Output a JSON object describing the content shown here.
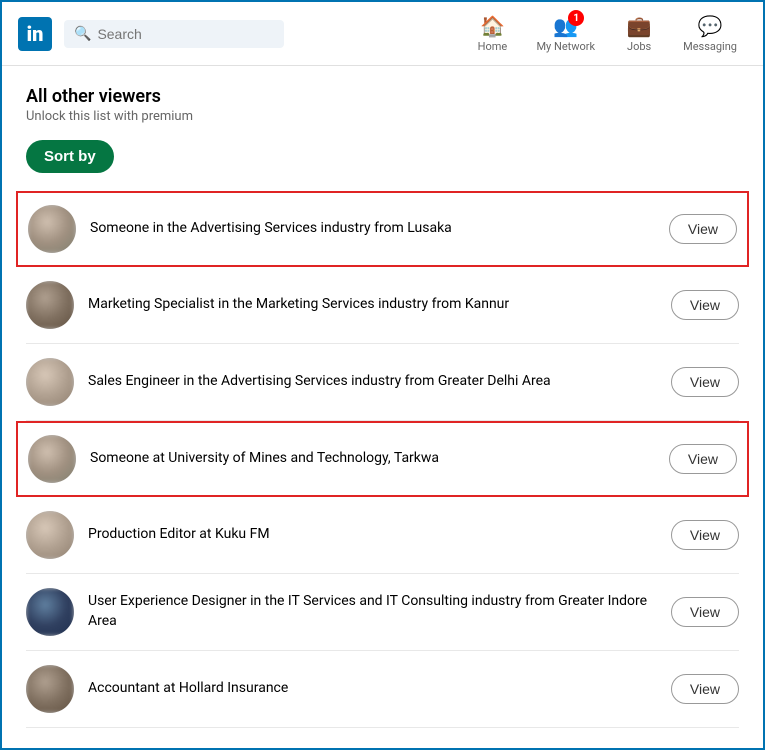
{
  "nav": {
    "logo_label": "in",
    "search_placeholder": "Search",
    "items": [
      {
        "id": "home",
        "label": "Home",
        "icon": "🏠",
        "badge": null
      },
      {
        "id": "my-network",
        "label": "My Network",
        "icon": "👥",
        "badge": "1"
      },
      {
        "id": "jobs",
        "label": "Jobs",
        "icon": "💼",
        "badge": null
      },
      {
        "id": "messaging",
        "label": "Messaging",
        "icon": "💬",
        "badge": null
      }
    ]
  },
  "section": {
    "title": "All other viewers",
    "subtitle": "Unlock this list with premium",
    "sort_button_label": "Sort by"
  },
  "viewers": [
    {
      "id": 1,
      "text": "Someone in the Advertising Services industry from Lusaka",
      "view_label": "View",
      "highlighted": true,
      "avatar_type": "blur"
    },
    {
      "id": 2,
      "text": "Marketing Specialist in the Marketing Services industry from Kannur",
      "view_label": "View",
      "highlighted": false,
      "avatar_type": "med"
    },
    {
      "id": 3,
      "text": "Sales Engineer in the Advertising Services industry from Greater Delhi Area",
      "view_label": "View",
      "highlighted": false,
      "avatar_type": "light"
    },
    {
      "id": 4,
      "text": "Someone at University of Mines and Technology, Tarkwa",
      "view_label": "View",
      "highlighted": true,
      "avatar_type": "blur"
    },
    {
      "id": 5,
      "text": "Production Editor at Kuku FM",
      "view_label": "View",
      "highlighted": false,
      "avatar_type": "light"
    },
    {
      "id": 6,
      "text": "User Experience Designer in the IT Services and IT Consulting industry from Greater Indore Area",
      "view_label": "View",
      "highlighted": false,
      "avatar_type": "dark"
    },
    {
      "id": 7,
      "text": "Accountant at Hollard Insurance",
      "view_label": "View",
      "highlighted": false,
      "avatar_type": "med"
    }
  ]
}
